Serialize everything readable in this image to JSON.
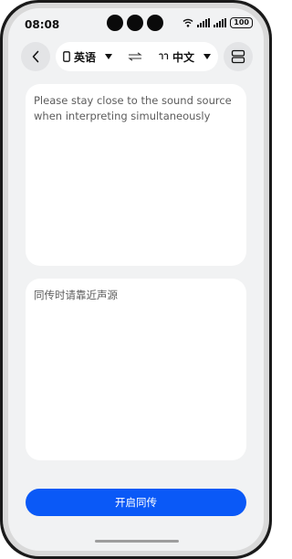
{
  "status_bar": {
    "time": "08:08",
    "battery": "100",
    "icons": [
      "wifi-icon",
      "signal-icon",
      "signal-icon",
      "battery-icon"
    ]
  },
  "toolbar": {
    "back_icon": "chevron-left-icon",
    "source_language": "英语",
    "source_device_icon": "phone-icon",
    "swap_icon": "swap-arrows-icon",
    "target_language": "中文",
    "target_device_icon": "earbuds-icon",
    "layout_icon": "split-layout-icon"
  },
  "source_panel": {
    "text": "Please stay close to the sound source when interpreting simultaneously"
  },
  "target_panel": {
    "text": "同传时请靠近声源"
  },
  "primary_action": {
    "label": "开启同传"
  },
  "colors": {
    "background": "#f1f2f3",
    "card": "#ffffff",
    "accent": "#0a59f7",
    "placeholder_text": "#5c5c5c"
  }
}
